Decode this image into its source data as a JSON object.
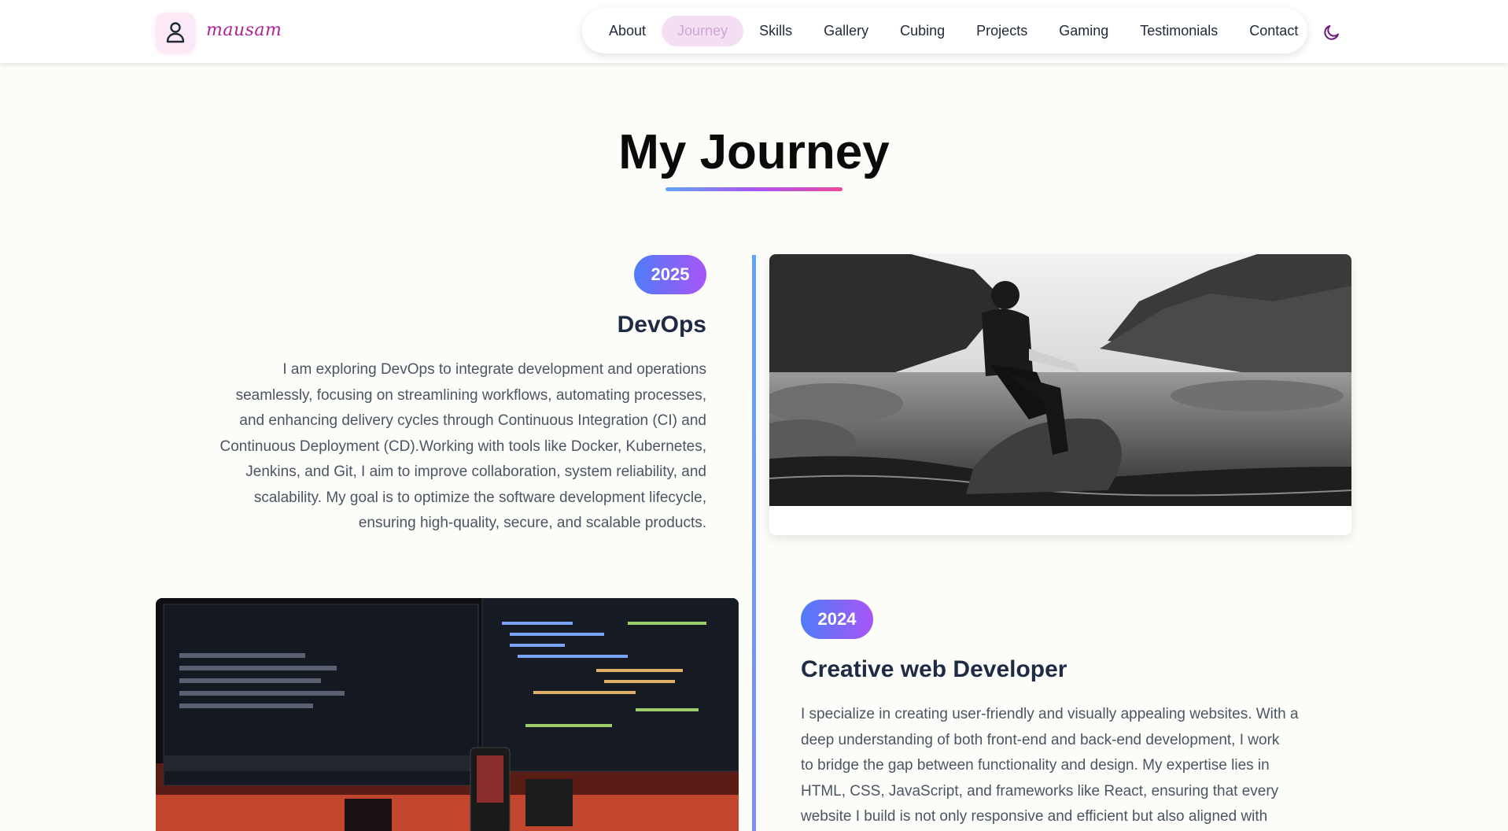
{
  "brand": {
    "name": "mausam",
    "logo_icon": "user-icon"
  },
  "nav": {
    "items": [
      {
        "label": "About",
        "active": false
      },
      {
        "label": "Journey",
        "active": true
      },
      {
        "label": "Skills",
        "active": false
      },
      {
        "label": "Gallery",
        "active": false
      },
      {
        "label": "Cubing",
        "active": false
      },
      {
        "label": "Projects",
        "active": false
      },
      {
        "label": "Gaming",
        "active": false
      },
      {
        "label": "Testimonials",
        "active": false
      },
      {
        "label": "Contact",
        "active": false
      }
    ],
    "theme_toggle_icon": "moon-icon"
  },
  "page": {
    "title": "My Journey"
  },
  "timeline": [
    {
      "year": "2025",
      "title": "DevOps",
      "description_lines": [
        "I am exploring DevOps to integrate development and operations",
        "seamlessly, focusing on streamlining workflows, automating processes,",
        "and enhancing delivery cycles through Continuous Integration (CI) and",
        "Continuous Deployment (CD).Working with tools like Docker, Kubernetes,",
        "Jenkins, and Git, I aim to improve collaboration, system reliability, and",
        "scalability. My goal is to optimize the software development lifecycle,",
        "ensuring high-quality, secure, and scalable products."
      ]
    },
    {
      "year": "2024",
      "title": "Creative web Developer",
      "description_lines": [
        "I specialize in creating user-friendly and visually appealing websites. With a",
        "deep understanding of both front-end and back-end development, I work",
        "to bridge the gap between functionality and design. My expertise lies in",
        "HTML, CSS, JavaScript, and frameworks like React, ensuring that every",
        "website I build is not only responsive and efficient but also aligned with"
      ]
    }
  ],
  "colors": {
    "accent_pink": "#ec4899",
    "accent_purple": "#a855f7",
    "accent_blue": "#60a5fa",
    "brand_magenta": "#b0229a"
  }
}
